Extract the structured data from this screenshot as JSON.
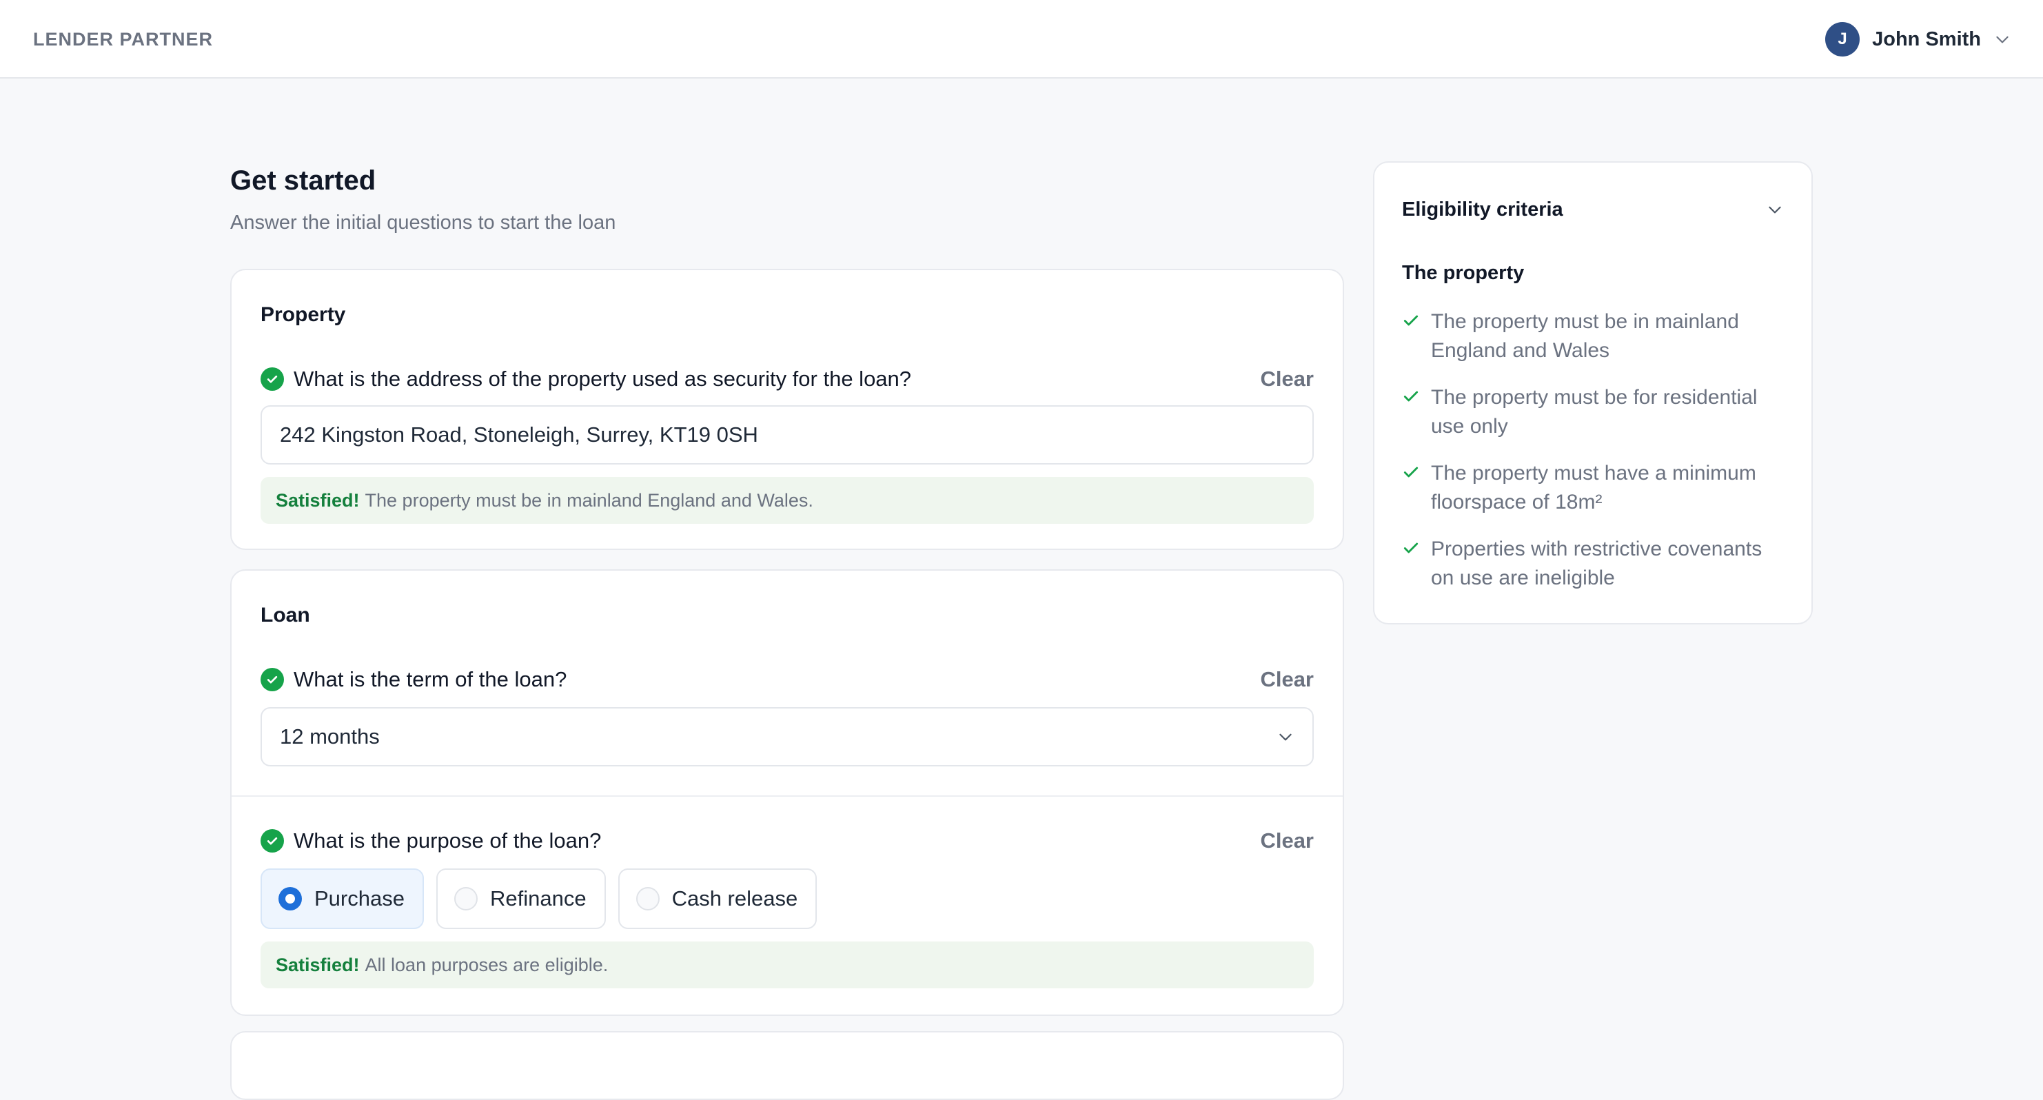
{
  "header": {
    "brand": "LENDER PARTNER",
    "user": {
      "initial": "J",
      "name": "John Smith"
    }
  },
  "page": {
    "title": "Get started",
    "subtitle": "Answer the initial questions to start the loan"
  },
  "property": {
    "section_title": "Property",
    "question": "What is the address of the property used as security for the loan?",
    "clear_label": "Clear",
    "value": "242 Kingston Road, Stoneleigh, Surrey, KT19 0SH",
    "status_label": "Satisfied!",
    "status_message": "The property must be in mainland England and Wales."
  },
  "loan": {
    "section_title": "Loan",
    "term": {
      "question": "What is the term of the loan?",
      "clear_label": "Clear",
      "value": "12 months"
    },
    "purpose": {
      "question": "What is the purpose of the loan?",
      "clear_label": "Clear",
      "options": [
        {
          "label": "Purchase",
          "selected": true
        },
        {
          "label": "Refinance",
          "selected": false
        },
        {
          "label": "Cash release",
          "selected": false
        }
      ],
      "status_label": "Satisfied!",
      "status_message": "All loan purposes are eligible."
    }
  },
  "sidebar": {
    "title": "Eligibility criteria",
    "section": "The property",
    "criteria": [
      "The property must be in mainland England and Wales",
      "The property must be for residential use only",
      "The property must have a minimum floorspace of 18m²",
      "Properties with restrictive covenants on use are ineligible"
    ]
  },
  "colors": {
    "accent": "#1e6fd9",
    "success": "#16a34a",
    "avatar": "#2f4f86"
  }
}
